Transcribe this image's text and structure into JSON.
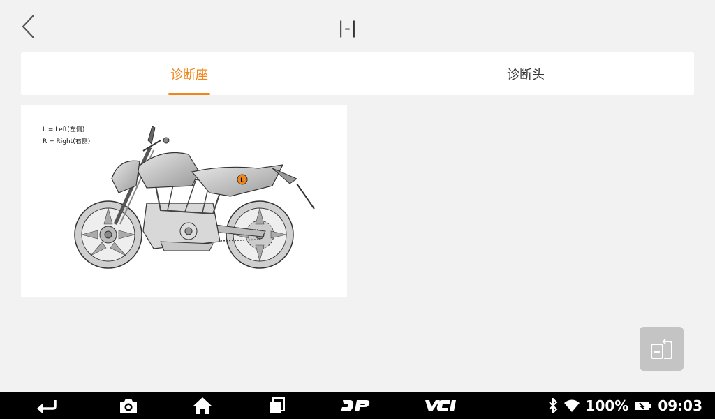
{
  "header": {
    "title": "|-|"
  },
  "tabs": [
    {
      "label": "诊断座",
      "active": true
    },
    {
      "label": "诊断头",
      "active": false
    }
  ],
  "diagram": {
    "legend_left": "L = Left(左侧)",
    "legend_right": "R = Right(右侧)",
    "marker_label": "L"
  },
  "statusbar": {
    "battery": "100%",
    "time": "09:03"
  },
  "colors": {
    "accent": "#f08519",
    "navbar": "#000000"
  },
  "icons": [
    "back-arrow-icon",
    "screenshot-camera-icon",
    "home-icon",
    "recent-apps-icon",
    "dp-icon",
    "vci-icon",
    "bluetooth-icon",
    "wifi-icon",
    "battery-icon",
    "rotate-screen-icon"
  ]
}
